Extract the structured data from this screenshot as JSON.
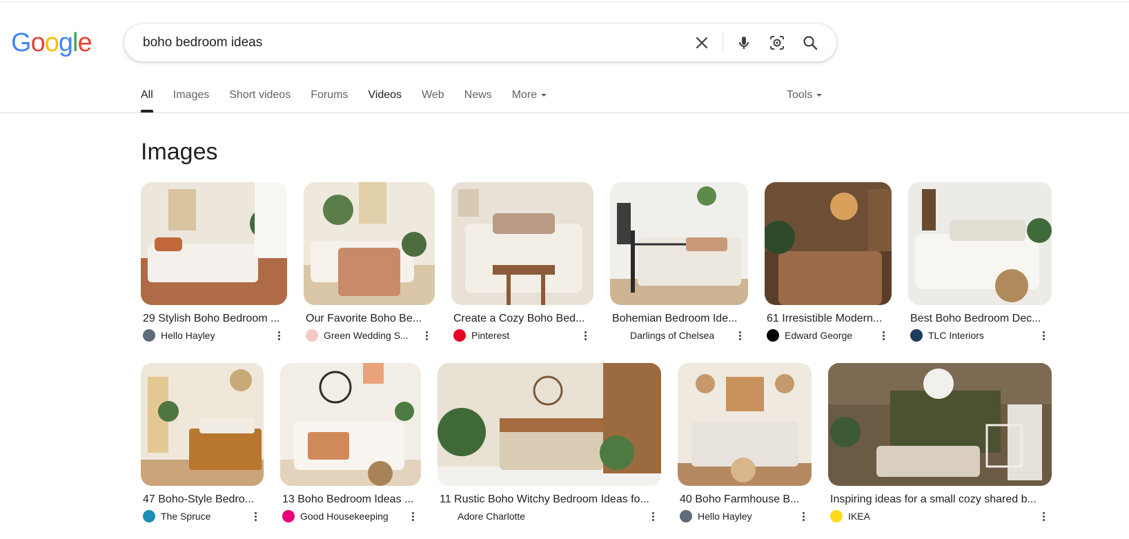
{
  "logo": {
    "letters": [
      "G",
      "o",
      "o",
      "g",
      "l",
      "e"
    ],
    "colors": [
      "#4285F4",
      "#EA4335",
      "#FBBC05",
      "#4285F4",
      "#34A853",
      "#EA4335"
    ]
  },
  "search": {
    "query": "boho bedroom ideas",
    "icons": [
      "close-icon",
      "mic-icon",
      "camera-lens-icon",
      "search-icon"
    ]
  },
  "tabs": [
    {
      "label": "All",
      "active": true
    },
    {
      "label": "Images"
    },
    {
      "label": "Short videos"
    },
    {
      "label": "Forums"
    },
    {
      "label": "Videos",
      "bold": true
    },
    {
      "label": "Web"
    },
    {
      "label": "News"
    },
    {
      "label": "More"
    }
  ],
  "tools_label": "Tools",
  "section_title": "Images",
  "images": [
    {
      "title": "29 Stylish Boho Bedroom ...",
      "source": "Hello Hayley",
      "favicon_color": "#5f6b7a"
    },
    {
      "title": "Our Favorite Boho Be...",
      "source": "Green Wedding S...",
      "favicon_color": "#f2c9c2"
    },
    {
      "title": "Create a Cozy Boho Bed...",
      "source": "Pinterest",
      "favicon_color": "#e60023"
    },
    {
      "title": "Bohemian Bedroom Ide...",
      "source": "Darlings of Chelsea",
      "favicon_color": "#ffffff"
    },
    {
      "title": "61 Irresistible Modern...",
      "source": "Edward George",
      "favicon_color": "#000000"
    },
    {
      "title": "Best Boho Bedroom Dec...",
      "source": "TLC Interiors",
      "favicon_color": "#1d3b5a"
    },
    {
      "title": "47 Boho-Style Bedro...",
      "source": "The Spruce",
      "favicon_color": "#1a8fb5"
    },
    {
      "title": "13 Boho Bedroom Ideas ...",
      "source": "Good Housekeeping",
      "favicon_color": "#e6007e"
    },
    {
      "title": "11 Rustic Boho Witchy Bedroom Ideas fo...",
      "source": "Adore Charlotte",
      "favicon_color": "#ffffff"
    },
    {
      "title": "40 Boho Farmhouse B...",
      "source": "Hello Hayley",
      "favicon_color": "#5f6b7a"
    },
    {
      "title": "Inspiring ideas for a small cozy shared b...",
      "source": "IKEA",
      "favicon_color": "#ffda1a"
    }
  ]
}
